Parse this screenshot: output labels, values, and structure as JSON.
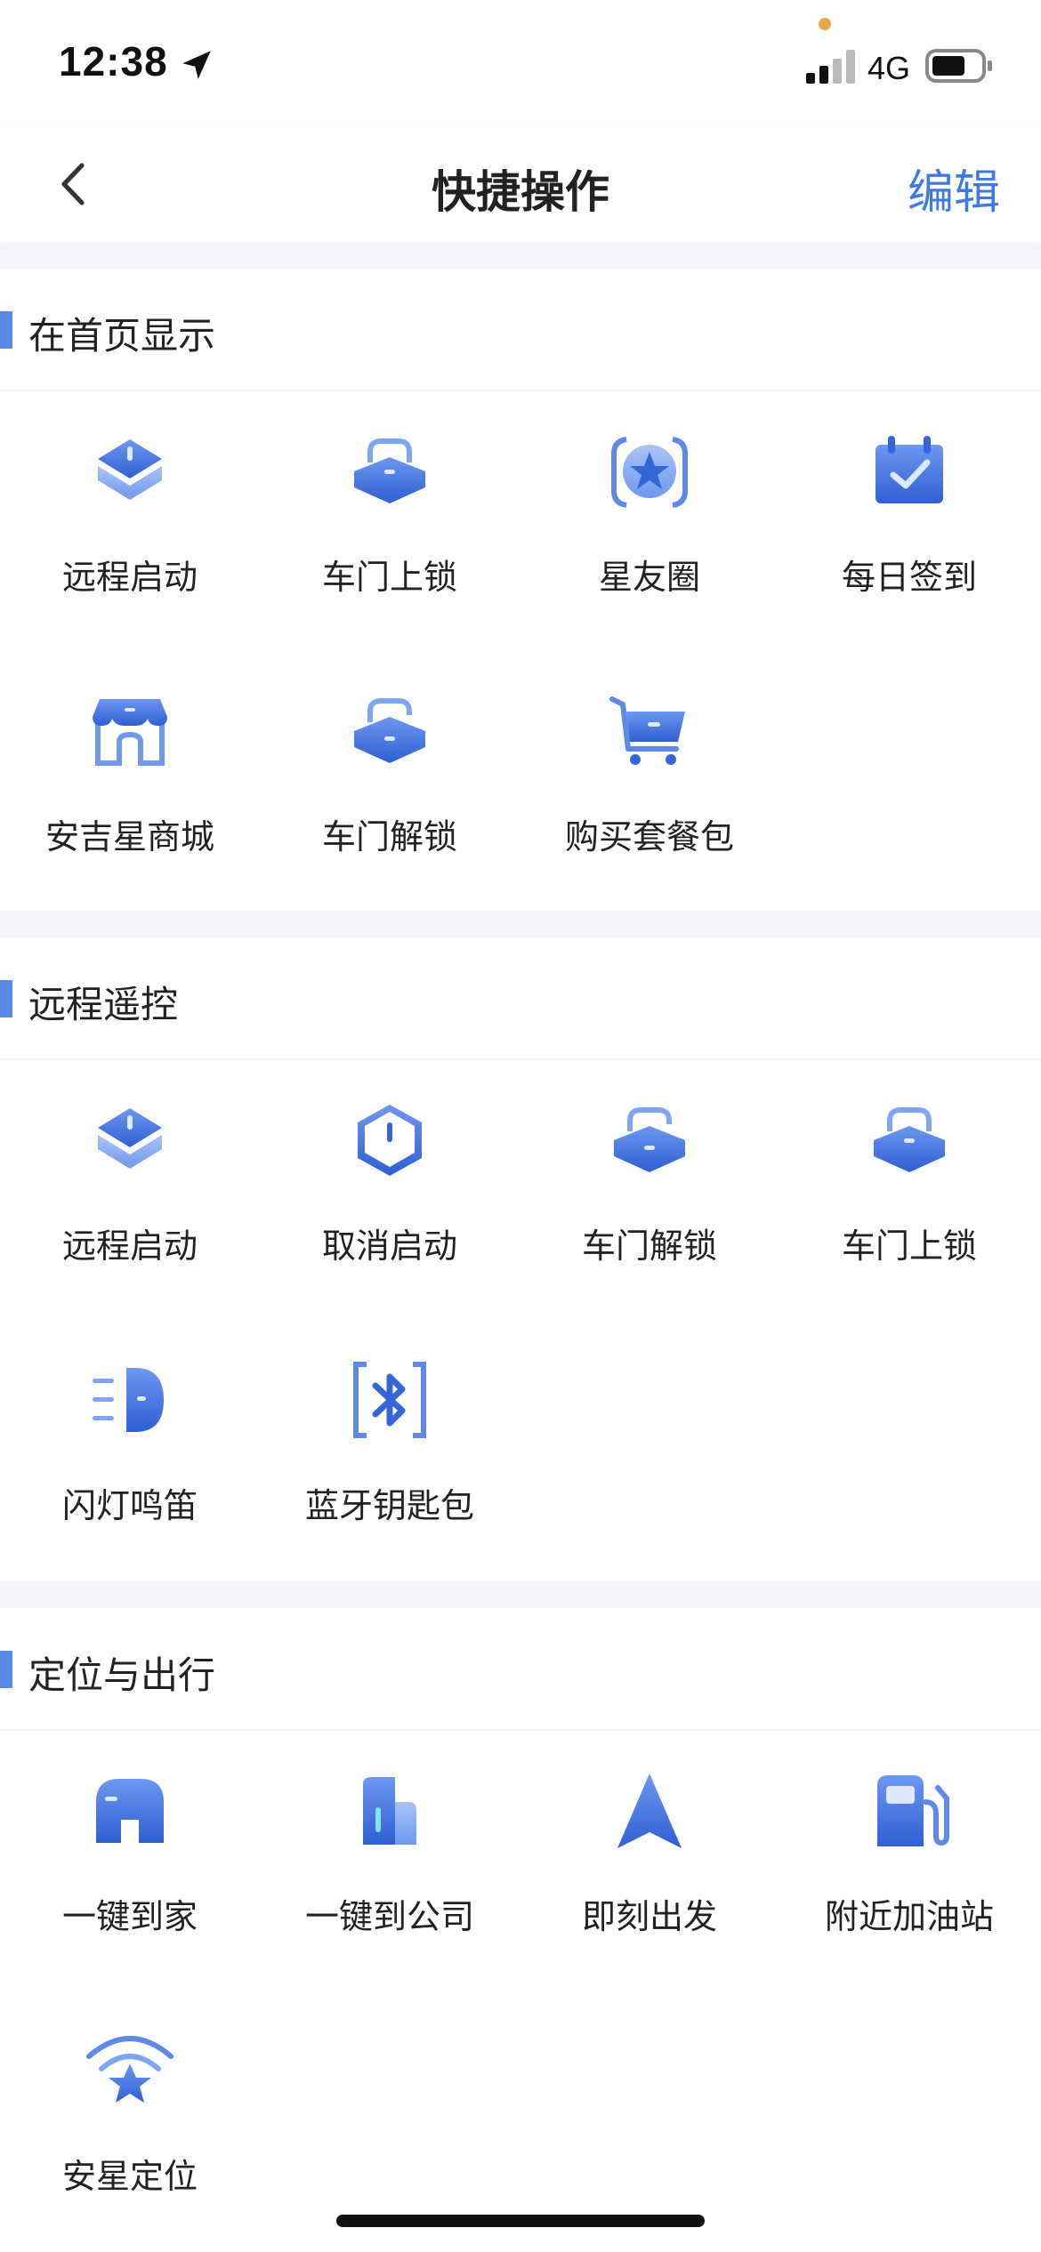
{
  "status_bar": {
    "time": "12:38",
    "network": "4G"
  },
  "nav": {
    "title": "快捷操作",
    "edit_label": "编辑"
  },
  "colors": {
    "accent": "#3d7be0",
    "icon_dark": "#3566d8",
    "icon_light": "#7fa6f2"
  },
  "sections": [
    {
      "title": "在首页显示",
      "items": [
        {
          "label": "远程启动",
          "icon": "remote-start-icon"
        },
        {
          "label": "车门上锁",
          "icon": "door-lock-icon"
        },
        {
          "label": "星友圈",
          "icon": "star-circle-icon"
        },
        {
          "label": "每日签到",
          "icon": "calendar-check-icon"
        },
        {
          "label": "安吉星商城",
          "icon": "store-icon"
        },
        {
          "label": "车门解锁",
          "icon": "door-unlock-icon"
        },
        {
          "label": "购买套餐包",
          "icon": "cart-icon"
        }
      ]
    },
    {
      "title": "远程遥控",
      "items": [
        {
          "label": "远程启动",
          "icon": "remote-start-icon"
        },
        {
          "label": "取消启动",
          "icon": "cancel-start-icon"
        },
        {
          "label": "车门解锁",
          "icon": "door-unlock-icon"
        },
        {
          "label": "车门上锁",
          "icon": "door-lock-icon"
        },
        {
          "label": "闪灯鸣笛",
          "icon": "headlight-horn-icon"
        },
        {
          "label": "蓝牙钥匙包",
          "icon": "bluetooth-key-icon"
        }
      ]
    },
    {
      "title": "定位与出行",
      "items": [
        {
          "label": "一键到家",
          "icon": "home-icon"
        },
        {
          "label": "一键到公司",
          "icon": "office-building-icon"
        },
        {
          "label": "即刻出发",
          "icon": "navigate-arrow-icon"
        },
        {
          "label": "附近加油站",
          "icon": "gas-station-icon"
        },
        {
          "label": "安星定位",
          "icon": "star-locate-icon"
        }
      ]
    }
  ]
}
